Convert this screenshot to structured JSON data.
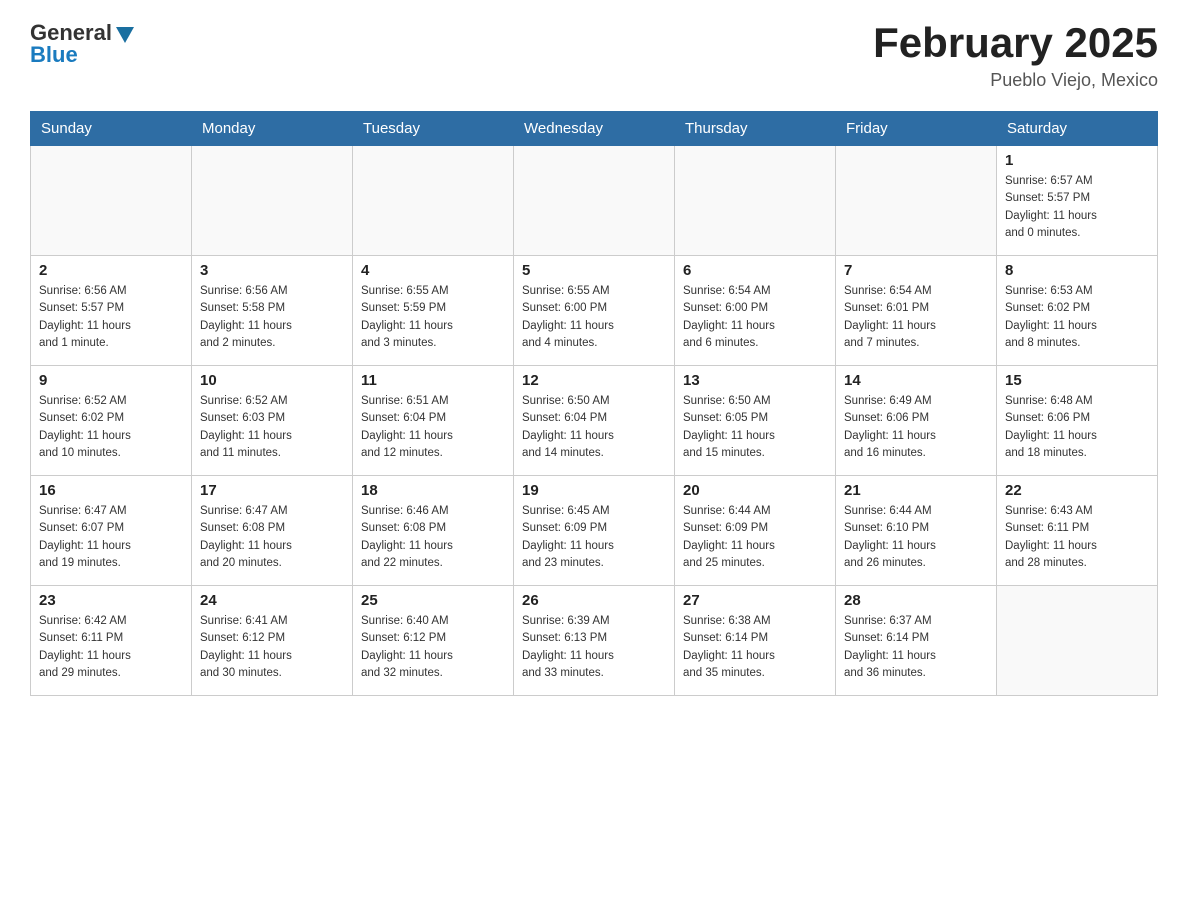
{
  "header": {
    "logo_general": "General",
    "logo_blue": "Blue",
    "month_title": "February 2025",
    "location": "Pueblo Viejo, Mexico"
  },
  "days_of_week": [
    "Sunday",
    "Monday",
    "Tuesday",
    "Wednesday",
    "Thursday",
    "Friday",
    "Saturday"
  ],
  "weeks": [
    [
      {
        "day": "",
        "info": ""
      },
      {
        "day": "",
        "info": ""
      },
      {
        "day": "",
        "info": ""
      },
      {
        "day": "",
        "info": ""
      },
      {
        "day": "",
        "info": ""
      },
      {
        "day": "",
        "info": ""
      },
      {
        "day": "1",
        "info": "Sunrise: 6:57 AM\nSunset: 5:57 PM\nDaylight: 11 hours\nand 0 minutes."
      }
    ],
    [
      {
        "day": "2",
        "info": "Sunrise: 6:56 AM\nSunset: 5:57 PM\nDaylight: 11 hours\nand 1 minute."
      },
      {
        "day": "3",
        "info": "Sunrise: 6:56 AM\nSunset: 5:58 PM\nDaylight: 11 hours\nand 2 minutes."
      },
      {
        "day": "4",
        "info": "Sunrise: 6:55 AM\nSunset: 5:59 PM\nDaylight: 11 hours\nand 3 minutes."
      },
      {
        "day": "5",
        "info": "Sunrise: 6:55 AM\nSunset: 6:00 PM\nDaylight: 11 hours\nand 4 minutes."
      },
      {
        "day": "6",
        "info": "Sunrise: 6:54 AM\nSunset: 6:00 PM\nDaylight: 11 hours\nand 6 minutes."
      },
      {
        "day": "7",
        "info": "Sunrise: 6:54 AM\nSunset: 6:01 PM\nDaylight: 11 hours\nand 7 minutes."
      },
      {
        "day": "8",
        "info": "Sunrise: 6:53 AM\nSunset: 6:02 PM\nDaylight: 11 hours\nand 8 minutes."
      }
    ],
    [
      {
        "day": "9",
        "info": "Sunrise: 6:52 AM\nSunset: 6:02 PM\nDaylight: 11 hours\nand 10 minutes."
      },
      {
        "day": "10",
        "info": "Sunrise: 6:52 AM\nSunset: 6:03 PM\nDaylight: 11 hours\nand 11 minutes."
      },
      {
        "day": "11",
        "info": "Sunrise: 6:51 AM\nSunset: 6:04 PM\nDaylight: 11 hours\nand 12 minutes."
      },
      {
        "day": "12",
        "info": "Sunrise: 6:50 AM\nSunset: 6:04 PM\nDaylight: 11 hours\nand 14 minutes."
      },
      {
        "day": "13",
        "info": "Sunrise: 6:50 AM\nSunset: 6:05 PM\nDaylight: 11 hours\nand 15 minutes."
      },
      {
        "day": "14",
        "info": "Sunrise: 6:49 AM\nSunset: 6:06 PM\nDaylight: 11 hours\nand 16 minutes."
      },
      {
        "day": "15",
        "info": "Sunrise: 6:48 AM\nSunset: 6:06 PM\nDaylight: 11 hours\nand 18 minutes."
      }
    ],
    [
      {
        "day": "16",
        "info": "Sunrise: 6:47 AM\nSunset: 6:07 PM\nDaylight: 11 hours\nand 19 minutes."
      },
      {
        "day": "17",
        "info": "Sunrise: 6:47 AM\nSunset: 6:08 PM\nDaylight: 11 hours\nand 20 minutes."
      },
      {
        "day": "18",
        "info": "Sunrise: 6:46 AM\nSunset: 6:08 PM\nDaylight: 11 hours\nand 22 minutes."
      },
      {
        "day": "19",
        "info": "Sunrise: 6:45 AM\nSunset: 6:09 PM\nDaylight: 11 hours\nand 23 minutes."
      },
      {
        "day": "20",
        "info": "Sunrise: 6:44 AM\nSunset: 6:09 PM\nDaylight: 11 hours\nand 25 minutes."
      },
      {
        "day": "21",
        "info": "Sunrise: 6:44 AM\nSunset: 6:10 PM\nDaylight: 11 hours\nand 26 minutes."
      },
      {
        "day": "22",
        "info": "Sunrise: 6:43 AM\nSunset: 6:11 PM\nDaylight: 11 hours\nand 28 minutes."
      }
    ],
    [
      {
        "day": "23",
        "info": "Sunrise: 6:42 AM\nSunset: 6:11 PM\nDaylight: 11 hours\nand 29 minutes."
      },
      {
        "day": "24",
        "info": "Sunrise: 6:41 AM\nSunset: 6:12 PM\nDaylight: 11 hours\nand 30 minutes."
      },
      {
        "day": "25",
        "info": "Sunrise: 6:40 AM\nSunset: 6:12 PM\nDaylight: 11 hours\nand 32 minutes."
      },
      {
        "day": "26",
        "info": "Sunrise: 6:39 AM\nSunset: 6:13 PM\nDaylight: 11 hours\nand 33 minutes."
      },
      {
        "day": "27",
        "info": "Sunrise: 6:38 AM\nSunset: 6:14 PM\nDaylight: 11 hours\nand 35 minutes."
      },
      {
        "day": "28",
        "info": "Sunrise: 6:37 AM\nSunset: 6:14 PM\nDaylight: 11 hours\nand 36 minutes."
      },
      {
        "day": "",
        "info": ""
      }
    ]
  ]
}
